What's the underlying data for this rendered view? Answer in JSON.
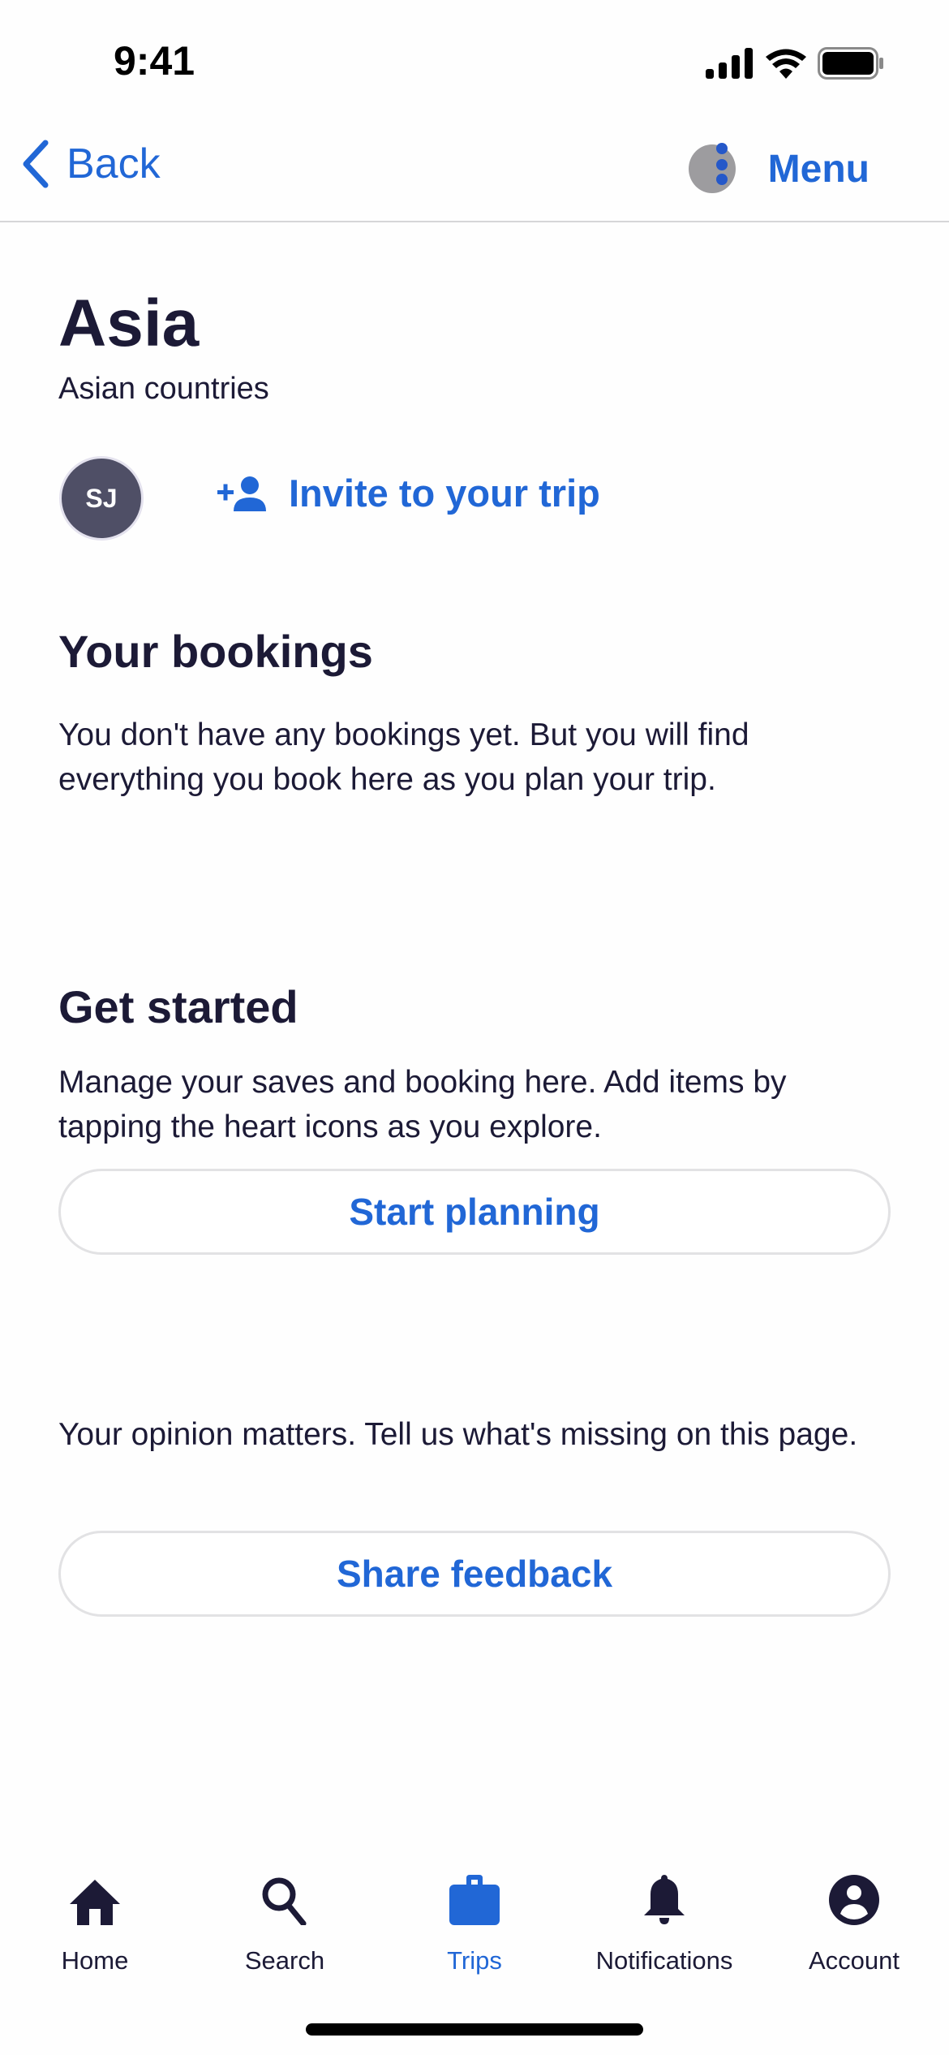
{
  "status_bar": {
    "time": "9:41",
    "icons": [
      "signal-icon",
      "wifi-icon",
      "battery-icon"
    ]
  },
  "nav": {
    "back_label": "Back",
    "back_icon": "chevron-left-icon",
    "menu_label": "Menu",
    "menu_icon": "more-vertical-icon"
  },
  "trip": {
    "title": "Asia",
    "subtitle": "Asian countries",
    "avatar_initials": "SJ",
    "invite_label": "Invite to your trip",
    "invite_icon": "add-person-icon"
  },
  "bookings": {
    "heading": "Your bookings",
    "text": "You don't have any bookings yet. But you will find everything you book here as you plan your trip."
  },
  "get_started": {
    "heading": "Get started",
    "text": "Manage your saves and booking here. Add items by tapping the heart icons as you explore.",
    "button_label": "Start planning"
  },
  "feedback": {
    "text": "Your opinion matters. Tell us what's missing on this page.",
    "button_label": "Share feedback"
  },
  "tabbar": {
    "active": "Trips",
    "items": [
      {
        "label": "Home",
        "icon": "home-icon"
      },
      {
        "label": "Search",
        "icon": "search-icon"
      },
      {
        "label": "Trips",
        "icon": "briefcase-icon"
      },
      {
        "label": "Notifications",
        "icon": "bell-icon"
      },
      {
        "label": "Account",
        "icon": "account-icon"
      }
    ]
  },
  "colors": {
    "accent": "#2167d6",
    "text": "#1c1a36",
    "avatar": "#4f4f66"
  }
}
